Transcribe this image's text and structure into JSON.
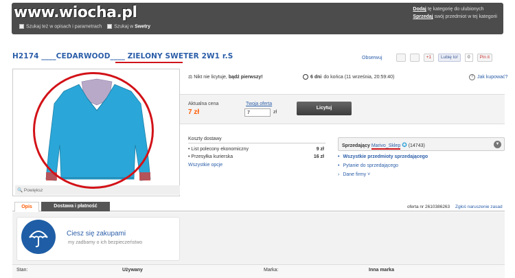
{
  "header": {
    "watermark": "www.wiocha.pl",
    "search_opt_1": "Szukaj też w opisach i parametrach",
    "search_opt_2_prefix": "Szukaj w",
    "search_opt_2_category": "Swetry",
    "add_link": "Dodaj",
    "add_text": "tę kategorię do ulubionych",
    "sell_link": "Sprzedaj",
    "sell_text": "swój przedmiot w tej kategorii"
  },
  "listing": {
    "title_prefix": "H2174 ____CEDARWOOD____",
    "title_highlight": "ZIELONY SWETER",
    "title_suffix": "2W1 r.S"
  },
  "actions": {
    "watch": "Obserwuj",
    "gplus": "+1",
    "fb_like": "Lubię to!",
    "fb_count": "0",
    "pin": "Pin it"
  },
  "photo": {
    "zoom_label": "Powiększ"
  },
  "auction": {
    "bids_text_prefix": "Nikt nie licytuje,",
    "bids_text_bold": "bądź pierwszy!",
    "days_bold": "6 dni",
    "days_text": "do końca (11 września, 20:59:40)",
    "help": "Jak kupować?",
    "current_label": "Aktualna cena",
    "current_value": "7 zł",
    "offer_label": "Twoja oferta",
    "offer_value": "7",
    "offer_unit": "zł",
    "bid_button": "Licytuj"
  },
  "shipping": {
    "title": "Koszty dostawy",
    "rows": [
      {
        "label": "List polecony ekonomiczny",
        "price": "9 zł"
      },
      {
        "label": "Przesyłka kurierska",
        "price": "16 zł"
      }
    ],
    "all_options": "Wszystkie opcje"
  },
  "seller": {
    "label": "Sprzedający",
    "name": "Marivo_Sklep",
    "rating": "(14743)",
    "links": [
      "Wszystkie przedmioty sprzedającego",
      "Pytanie do sprzedającego",
      "Dane firmy"
    ]
  },
  "tabs": {
    "description": "Opis",
    "delivery": "Dostawa i płatność",
    "offer_id": "oferta nr 2610386263",
    "report": "Zgłoś naruszenie zasad"
  },
  "promo": {
    "title": "Ciesz się zakupami",
    "subtitle": "my zadbamy o ich bezpieczeństwo"
  },
  "attributes": {
    "state_label": "Stan:",
    "state_value": "Używany",
    "brand_label": "Marka:",
    "brand_value": "Inna marka"
  }
}
